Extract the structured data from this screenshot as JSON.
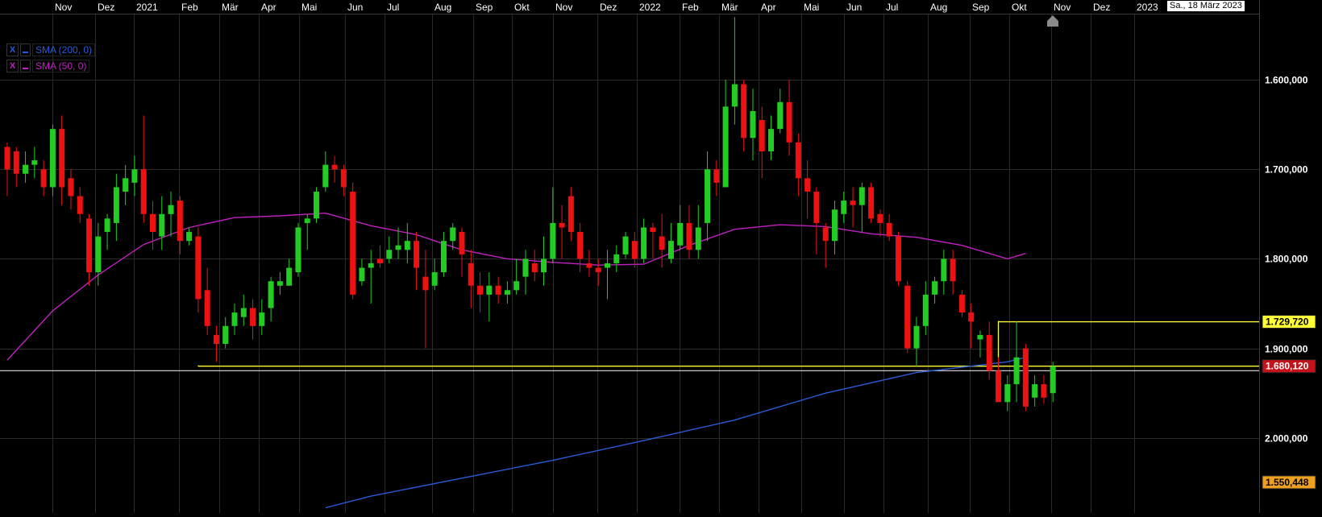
{
  "months": [
    "Nov",
    "Dez",
    "2021",
    "Feb",
    "Mär",
    "Apr",
    "Mai",
    "Jun",
    "Jul",
    "Aug",
    "Sep",
    "Okt",
    "Nov",
    "Dez",
    "2022",
    "Feb",
    "Mär",
    "Apr",
    "Mai",
    "Jun",
    "Jul",
    "Aug",
    "Sep",
    "Okt",
    "Nov",
    "Dez",
    "2023"
  ],
  "date_stamp": "Sa., 18 März 2023",
  "legend": [
    {
      "close": "X",
      "label": "SMA (200, 0)",
      "color": "#2a5bd7"
    },
    {
      "close": "X",
      "label": "SMA (50, 0)",
      "color": "#c020c0"
    }
  ],
  "price_ticks": [
    "2.000,000",
    "1.900,000",
    "1.800,000",
    "1.700,000",
    "1.600,000"
  ],
  "price_labels": {
    "high_line": "1.729,720",
    "last": "1.680,120",
    "sma200": "1.550,448"
  },
  "colors": {
    "up": "#22cc22",
    "down": "#ee1111",
    "sma200": "#2a5bd7",
    "sma50": "#c020c0",
    "yellow": "#ffff33",
    "grid": "#2a2a2a",
    "axis_text": "#ffffff"
  },
  "chart_data": {
    "type": "candlestick",
    "timeframe": "weekly",
    "ylim": [
      1525,
      2070
    ],
    "y_ticks": [
      1600,
      1700,
      1800,
      1900,
      2000
    ],
    "horizontal_lines": [
      {
        "value": 1729.72,
        "color": "#ffff33",
        "from_index": 109
      },
      {
        "value": 1680.12,
        "color": "#ffff33",
        "from_index": 21
      },
      {
        "value": 1675,
        "color": "#c8c8c8"
      }
    ],
    "last_price": 1680.12,
    "sma200_last": 1550.448,
    "sma200": [
      [
        35,
        1522
      ],
      [
        40,
        1535
      ],
      [
        50,
        1555
      ],
      [
        60,
        1575
      ],
      [
        70,
        1597
      ],
      [
        80,
        1620
      ],
      [
        90,
        1650
      ],
      [
        100,
        1673
      ],
      [
        110,
        1685
      ],
      [
        112,
        1690
      ]
    ],
    "sma50": [
      [
        0,
        1687
      ],
      [
        5,
        1742
      ],
      [
        10,
        1782
      ],
      [
        15,
        1816
      ],
      [
        20,
        1835
      ],
      [
        25,
        1846
      ],
      [
        30,
        1848
      ],
      [
        35,
        1851
      ],
      [
        40,
        1837
      ],
      [
        45,
        1827
      ],
      [
        50,
        1810
      ],
      [
        55,
        1800
      ],
      [
        60,
        1796
      ],
      [
        65,
        1793
      ],
      [
        70,
        1794
      ],
      [
        75,
        1815
      ],
      [
        80,
        1833
      ],
      [
        85,
        1838
      ],
      [
        90,
        1836
      ],
      [
        95,
        1828
      ],
      [
        100,
        1824
      ],
      [
        105,
        1815
      ],
      [
        110,
        1800
      ],
      [
        112,
        1806
      ]
    ],
    "candles": [
      [
        1925,
        1900,
        1930,
        1870
      ],
      [
        1920,
        1895,
        1925,
        1880
      ],
      [
        1895,
        1905,
        1920,
        1885
      ],
      [
        1905,
        1910,
        1925,
        1890
      ],
      [
        1900,
        1880,
        1910,
        1870
      ],
      [
        1880,
        1945,
        1950,
        1870
      ],
      [
        1945,
        1880,
        1960,
        1860
      ],
      [
        1890,
        1870,
        1900,
        1855
      ],
      [
        1870,
        1850,
        1880,
        1840
      ],
      [
        1845,
        1785,
        1850,
        1770
      ],
      [
        1785,
        1825,
        1840,
        1770
      ],
      [
        1830,
        1845,
        1850,
        1810
      ],
      [
        1840,
        1880,
        1895,
        1820
      ],
      [
        1875,
        1890,
        1905,
        1860
      ],
      [
        1885,
        1900,
        1915,
        1870
      ],
      [
        1900,
        1850,
        1960,
        1840
      ],
      [
        1850,
        1830,
        1865,
        1810
      ],
      [
        1825,
        1850,
        1870,
        1810
      ],
      [
        1850,
        1860,
        1875,
        1825
      ],
      [
        1865,
        1820,
        1870,
        1805
      ],
      [
        1820,
        1830,
        1835,
        1815
      ],
      [
        1825,
        1755,
        1835,
        1740
      ],
      [
        1765,
        1725,
        1790,
        1715
      ],
      [
        1715,
        1705,
        1725,
        1685
      ],
      [
        1705,
        1725,
        1735,
        1700
      ],
      [
        1725,
        1740,
        1750,
        1715
      ],
      [
        1735,
        1745,
        1760,
        1725
      ],
      [
        1745,
        1725,
        1755,
        1710
      ],
      [
        1725,
        1740,
        1755,
        1715
      ],
      [
        1745,
        1775,
        1780,
        1730
      ],
      [
        1770,
        1775,
        1785,
        1760
      ],
      [
        1770,
        1790,
        1800,
        1770
      ],
      [
        1785,
        1835,
        1840,
        1780
      ],
      [
        1840,
        1845,
        1850,
        1810
      ],
      [
        1845,
        1875,
        1880,
        1840
      ],
      [
        1880,
        1905,
        1920,
        1875
      ],
      [
        1905,
        1900,
        1915,
        1885
      ],
      [
        1900,
        1880,
        1905,
        1870
      ],
      [
        1875,
        1760,
        1885,
        1755
      ],
      [
        1775,
        1790,
        1800,
        1770
      ],
      [
        1790,
        1795,
        1810,
        1750
      ],
      [
        1800,
        1795,
        1815,
        1790
      ],
      [
        1800,
        1810,
        1825,
        1795
      ],
      [
        1810,
        1815,
        1835,
        1800
      ],
      [
        1810,
        1820,
        1840,
        1795
      ],
      [
        1820,
        1790,
        1830,
        1765
      ],
      [
        1780,
        1765,
        1810,
        1700
      ],
      [
        1770,
        1785,
        1800,
        1765
      ],
      [
        1785,
        1820,
        1830,
        1780
      ],
      [
        1820,
        1835,
        1840,
        1810
      ],
      [
        1830,
        1805,
        1835,
        1780
      ],
      [
        1795,
        1770,
        1810,
        1745
      ],
      [
        1770,
        1760,
        1785,
        1740
      ],
      [
        1760,
        1770,
        1785,
        1730
      ],
      [
        1770,
        1760,
        1780,
        1750
      ],
      [
        1760,
        1765,
        1775,
        1750
      ],
      [
        1765,
        1775,
        1800,
        1760
      ],
      [
        1780,
        1800,
        1810,
        1760
      ],
      [
        1795,
        1785,
        1810,
        1775
      ],
      [
        1785,
        1800,
        1825,
        1770
      ],
      [
        1800,
        1840,
        1880,
        1795
      ],
      [
        1840,
        1835,
        1860,
        1800
      ],
      [
        1870,
        1830,
        1880,
        1820
      ],
      [
        1830,
        1800,
        1840,
        1785
      ],
      [
        1795,
        1790,
        1810,
        1780
      ],
      [
        1790,
        1785,
        1800,
        1770
      ],
      [
        1790,
        1795,
        1810,
        1755
      ],
      [
        1795,
        1805,
        1815,
        1785
      ],
      [
        1805,
        1825,
        1830,
        1800
      ],
      [
        1820,
        1800,
        1830,
        1790
      ],
      [
        1800,
        1835,
        1845,
        1795
      ],
      [
        1835,
        1830,
        1840,
        1800
      ],
      [
        1825,
        1810,
        1850,
        1790
      ],
      [
        1800,
        1820,
        1840,
        1795
      ],
      [
        1815,
        1840,
        1860,
        1810
      ],
      [
        1840,
        1810,
        1860,
        1800
      ],
      [
        1810,
        1835,
        1860,
        1800
      ],
      [
        1840,
        1900,
        1920,
        1820
      ],
      [
        1900,
        1885,
        1910,
        1870
      ],
      [
        1880,
        1970,
        2000,
        1880
      ],
      [
        1970,
        1995,
        2070,
        1950
      ],
      [
        1995,
        1935,
        2000,
        1920
      ],
      [
        1935,
        1965,
        1990,
        1910
      ],
      [
        1955,
        1920,
        1970,
        1890
      ],
      [
        1920,
        1945,
        1960,
        1910
      ],
      [
        1945,
        1975,
        1990,
        1940
      ],
      [
        1975,
        1930,
        2000,
        1915
      ],
      [
        1930,
        1890,
        1940,
        1870
      ],
      [
        1890,
        1875,
        1910,
        1845
      ],
      [
        1875,
        1840,
        1880,
        1805
      ],
      [
        1835,
        1820,
        1840,
        1790
      ],
      [
        1820,
        1855,
        1865,
        1805
      ],
      [
        1850,
        1865,
        1875,
        1840
      ],
      [
        1865,
        1860,
        1880,
        1835
      ],
      [
        1860,
        1880,
        1885,
        1830
      ],
      [
        1880,
        1845,
        1885,
        1840
      ],
      [
        1850,
        1840,
        1855,
        1825
      ],
      [
        1840,
        1825,
        1850,
        1820
      ],
      [
        1825,
        1775,
        1830,
        1770
      ],
      [
        1770,
        1700,
        1775,
        1695
      ],
      [
        1700,
        1725,
        1735,
        1680
      ],
      [
        1725,
        1760,
        1775,
        1715
      ],
      [
        1760,
        1775,
        1780,
        1750
      ],
      [
        1775,
        1800,
        1810,
        1760
      ],
      [
        1800,
        1775,
        1810,
        1760
      ],
      [
        1760,
        1740,
        1765,
        1735
      ],
      [
        1740,
        1730,
        1750,
        1700
      ],
      [
        1710,
        1715,
        1720,
        1690
      ],
      [
        1715,
        1675,
        1730,
        1665
      ],
      [
        1675,
        1640,
        1690,
        1640
      ],
      [
        1640,
        1660,
        1670,
        1630
      ],
      [
        1660,
        1690,
        1730,
        1640
      ],
      [
        1700,
        1635,
        1705,
        1630
      ],
      [
        1645,
        1660,
        1670,
        1635
      ],
      [
        1660,
        1645,
        1670,
        1638
      ],
      [
        1650,
        1680,
        1685,
        1640
      ]
    ]
  }
}
